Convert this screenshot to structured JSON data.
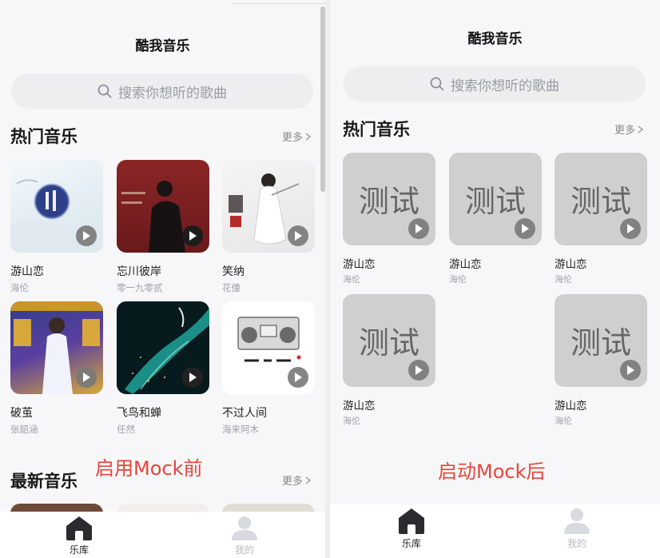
{
  "left": {
    "title": "酷我音乐",
    "search_placeholder": "搜索你想听的歌曲",
    "hot": {
      "title": "热门音乐",
      "more": "更多",
      "songs": [
        {
          "name": "游山恋",
          "artist": "海伦"
        },
        {
          "name": "忘川彼岸",
          "artist": "零一九零贰"
        },
        {
          "name": "笑纳",
          "artist": "花僮"
        },
        {
          "name": "破茧",
          "artist": "张韶涵"
        },
        {
          "name": "飞鸟和蝉",
          "artist": "任然"
        },
        {
          "name": "不过人间",
          "artist": "海来阿木"
        }
      ]
    },
    "latest": {
      "title": "最新音乐",
      "more": "更多"
    },
    "annotation": "启用Mock前",
    "tabs": [
      {
        "label": "乐库",
        "active": true
      },
      {
        "label": "我的",
        "active": false
      }
    ]
  },
  "right": {
    "title": "酷我音乐",
    "search_placeholder": "搜索你想听的歌曲",
    "hot": {
      "title": "热门音乐",
      "more": "更多",
      "cover_text": "测试",
      "songs": [
        {
          "name": "游山恋",
          "artist": "海伦"
        },
        {
          "name": "游山恋",
          "artist": "海伦"
        },
        {
          "name": "游山恋",
          "artist": "海伦"
        },
        {
          "name": "游山恋",
          "artist": "海伦"
        },
        {
          "name": "游山恋",
          "artist": "海伦"
        }
      ]
    },
    "annotation": "启动Mock后",
    "tabs": [
      {
        "label": "乐库",
        "active": true
      },
      {
        "label": "我的",
        "active": false
      }
    ]
  },
  "colors": {
    "annotation": "#e8443a",
    "mock_cover": "#cfcfcf",
    "play_button": "#787878"
  },
  "icons": {
    "search": "search-icon",
    "more": "chevron-right-icon",
    "play": "play-icon",
    "home": "home-icon",
    "user": "user-icon"
  }
}
